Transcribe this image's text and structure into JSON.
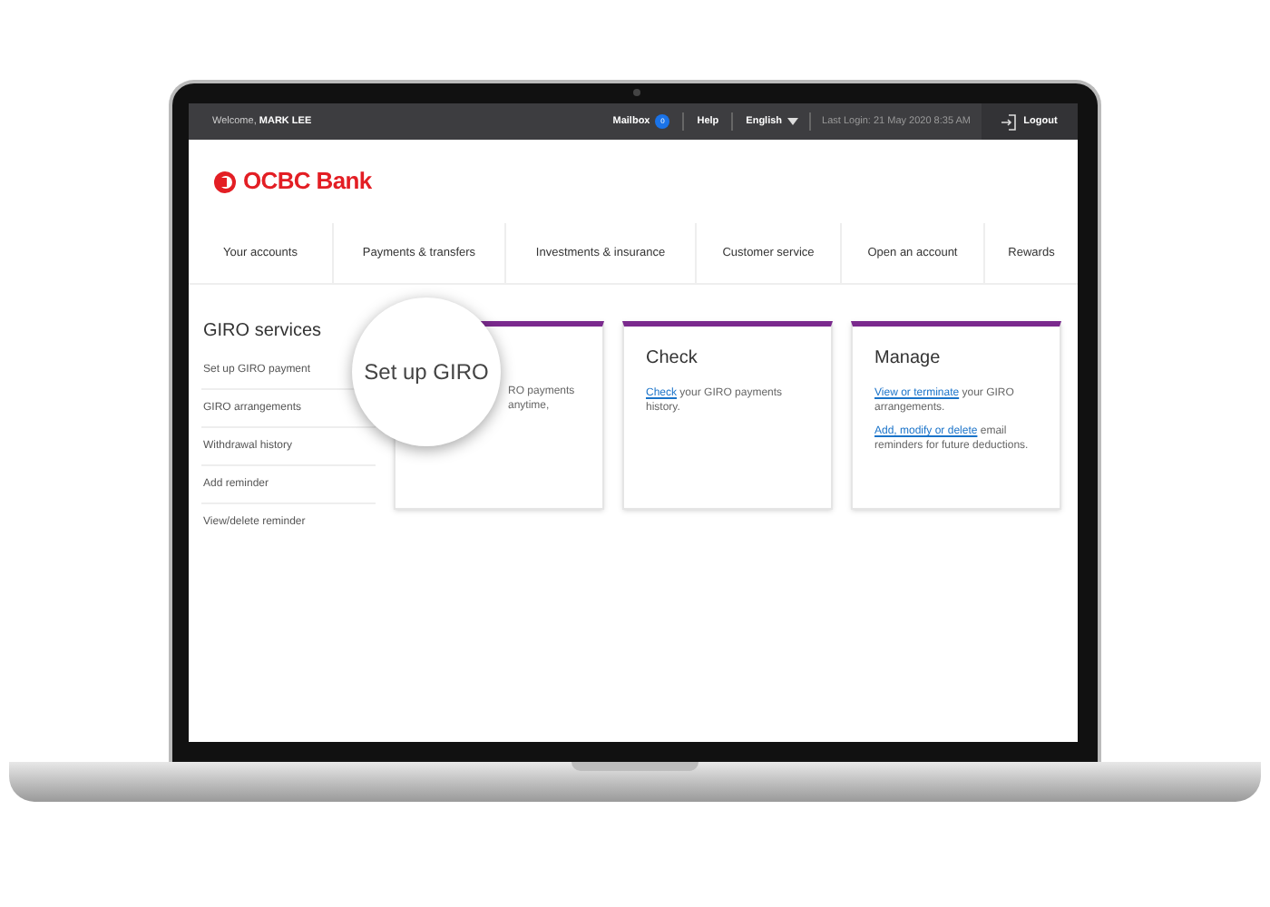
{
  "top_bar": {
    "welcome": "Welcome,",
    "user": "MARK LEE",
    "mailbox": "Mailbox",
    "mail_badge": "0",
    "help": "Help",
    "language": "English",
    "last_login": "Last Login: 21 May 2020 8:35 AM",
    "logout": "Logout"
  },
  "logo": {
    "text": "OCBC Bank"
  },
  "nav": [
    {
      "label": "Your accounts"
    },
    {
      "label": "Payments & transfers"
    },
    {
      "label": "Investments & insurance"
    },
    {
      "label": "Customer service"
    },
    {
      "label": "Open an account"
    },
    {
      "label": "Rewards"
    }
  ],
  "sidebar": {
    "title": "GIRO services",
    "items": [
      {
        "label": "Set up GIRO payment"
      },
      {
        "label": "GIRO arrangements"
      },
      {
        "label": "Withdrawal history"
      },
      {
        "label": "Add reminder"
      },
      {
        "label": "View/delete reminder"
      }
    ]
  },
  "magnifier": {
    "text": "Set up GIRO"
  },
  "cards": [
    {
      "paragraphs": [
        [
          {
            "text": "RO payments",
            "link": false
          }
        ],
        [
          {
            "text": "anytime,",
            "link": false
          }
        ]
      ],
      "covered": true
    },
    {
      "title": "Check",
      "paragraphs": [
        [
          {
            "text": "Check",
            "link": true
          },
          {
            "text": " your GIRO payments history.",
            "link": false
          }
        ]
      ],
      "covered": false
    },
    {
      "title": "Manage",
      "paragraphs": [
        [
          {
            "text": "View or terminate",
            "link": true
          },
          {
            "text": " your GIRO arrangements.",
            "link": false
          }
        ],
        [
          {
            "text": "Add, modify or delete",
            "link": true
          },
          {
            "text": " email reminders for future deductions.",
            "link": false
          }
        ]
      ],
      "covered": false
    }
  ]
}
